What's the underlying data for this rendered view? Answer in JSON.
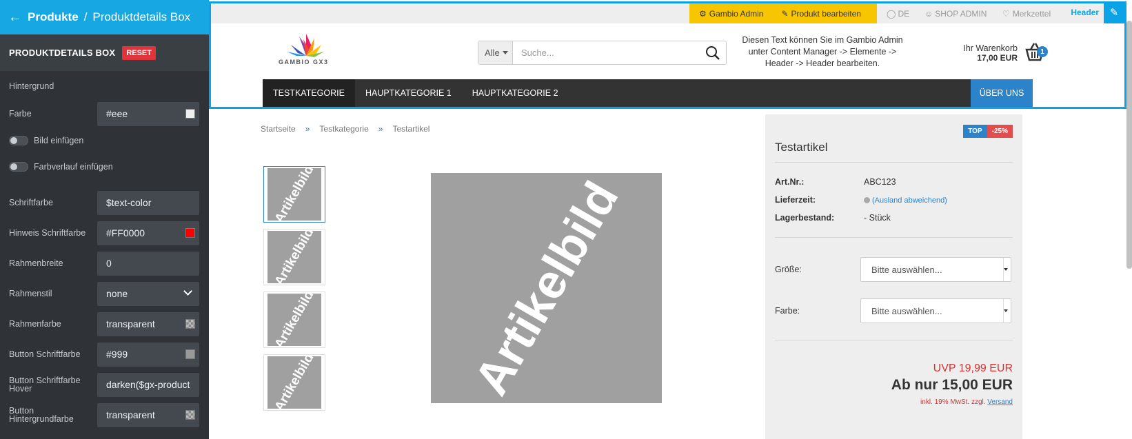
{
  "panel": {
    "back_label": "Produkte",
    "crumb_separator": "/",
    "crumb_current": "Produktdetails Box",
    "section_title": "PRODUKTDETAILS BOX",
    "reset_label": "RESET",
    "group_label": "Hintergrund",
    "color_label": "Farbe",
    "color_value": "#eee",
    "image_toggle_label": "Bild einfügen",
    "gradient_toggle_label": "Farbverlauf einfügen",
    "font_color_label": "Schriftfarbe",
    "font_color_value": "$text-color",
    "hint_font_color_label": "Hinweis Schriftfarbe",
    "hint_font_color_value": "#FF0000",
    "border_width_label": "Rahmenbreite",
    "border_width_value": "0",
    "border_style_label": "Rahmenstil",
    "border_style_value": "none",
    "border_color_label": "Rahmenfarbe",
    "border_color_value": "transparent",
    "button_font_color_label": "Button Schriftfarbe",
    "button_font_color_value": "#999",
    "button_font_color_hover_label": "Button Schriftfarbe Hover",
    "button_font_color_hover_value": "darken($gx-product",
    "button_bg_color_label": "Button Hintergrundfarbe",
    "button_bg_color_value": "transparent"
  },
  "colors": {
    "accent": "#0aa3e6",
    "panel_bg": "#2f3337",
    "admin_bar": "#f7c600",
    "brand_blue": "#2d83c9",
    "sale_red": "#e32d2d"
  },
  "topbar": {
    "gambio_admin": "Gambio Admin",
    "edit_product": "Produkt bearbeiten",
    "language": "DE",
    "shop_admin": "SHOP ADMIN",
    "wishlist": "Merkzettel",
    "header_label": "Header"
  },
  "header": {
    "logo_text": "GAMBIO GX3",
    "search_category": "Alle",
    "search_placeholder": "Suche...",
    "info_text_line1": "Diesen Text können Sie im Gambio Admin",
    "info_text_line2": "unter Content Manager -> Elemente ->",
    "info_text_line3": "Header -> Header bearbeiten.",
    "cart_label": "Ihr Warenkorb",
    "cart_sum": "17,00 EUR",
    "cart_count": "1"
  },
  "nav": {
    "items": [
      "TESTKATEGORIE",
      "HAUPTKATEGORIE 1",
      "HAUPTKATEGORIE 2"
    ],
    "about": "ÜBER UNS"
  },
  "breadcrumb": {
    "home": "Startseite",
    "separator": "»",
    "category": "Testkategorie",
    "current": "Testartikel"
  },
  "images": {
    "placeholder_text": "Artikelbild"
  },
  "product": {
    "badge_top": "TOP",
    "badge_discount": "-25%",
    "name": "Testartikel",
    "art_nr_label": "Art.Nr.:",
    "art_nr_value": "ABC123",
    "delivery_label": "Lieferzeit:",
    "delivery_value": "(Ausland abweichend)",
    "stock_label": "Lagerbestand:",
    "stock_value": "- Stück",
    "size_label": "Größe:",
    "size_value": "Bitte auswählen...",
    "color_label": "Farbe:",
    "color_value": "Bitte auswählen...",
    "uvp": "UVP 19,99 EUR",
    "price": "Ab nur 15,00 EUR",
    "tax_text": "inkl. 19% MwSt. zzgl.",
    "shipping_link": "Versand"
  }
}
